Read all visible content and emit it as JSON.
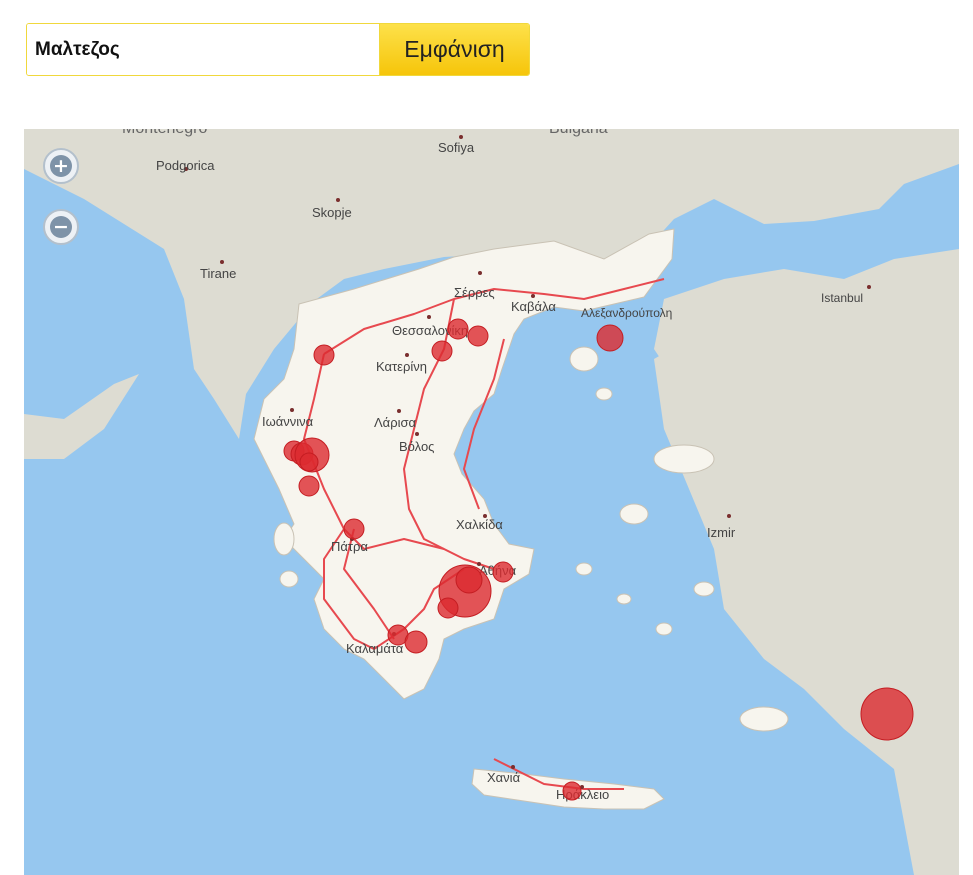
{
  "search": {
    "value": "Μαλτεζος",
    "button_label": "Εμφάνιση"
  },
  "map": {
    "colors": {
      "sea": "#96c7ef",
      "land": "#dddcd2",
      "greece": "#f7f5ee",
      "road": "#e7494f",
      "marker": "#dc2b2f"
    },
    "labels": {
      "montenegro": "Montenegro",
      "bulgaria": "Bulgaria",
      "podgorica": "Podgorica",
      "sofiya": "Sofiya",
      "skopje": "Skopje",
      "tirane": "Tirane",
      "istanbul": "Istanbul",
      "serres": "Σέρρες",
      "kavala": "Καβάλα",
      "alexandroupoli": "Αλεξανδρούπολη",
      "thessaloniki": "Θεσσαλονίκη",
      "katerini": "Κατερίνη",
      "ioannina": "Ιωάννινα",
      "larisa": "Λάρισα",
      "volos": "Βόλος",
      "chalkida": "Χαλκίδα",
      "izmir": "Izmir",
      "patra": "Πάτρα",
      "athina": "Αθήνα",
      "kalamata": "Καλαμάτα",
      "chania": "Χανιά",
      "irakleio": "Ηράκλειο"
    },
    "zoom_in_icon": "plus-icon",
    "zoom_out_icon": "minus-icon",
    "marker_count": 24
  }
}
